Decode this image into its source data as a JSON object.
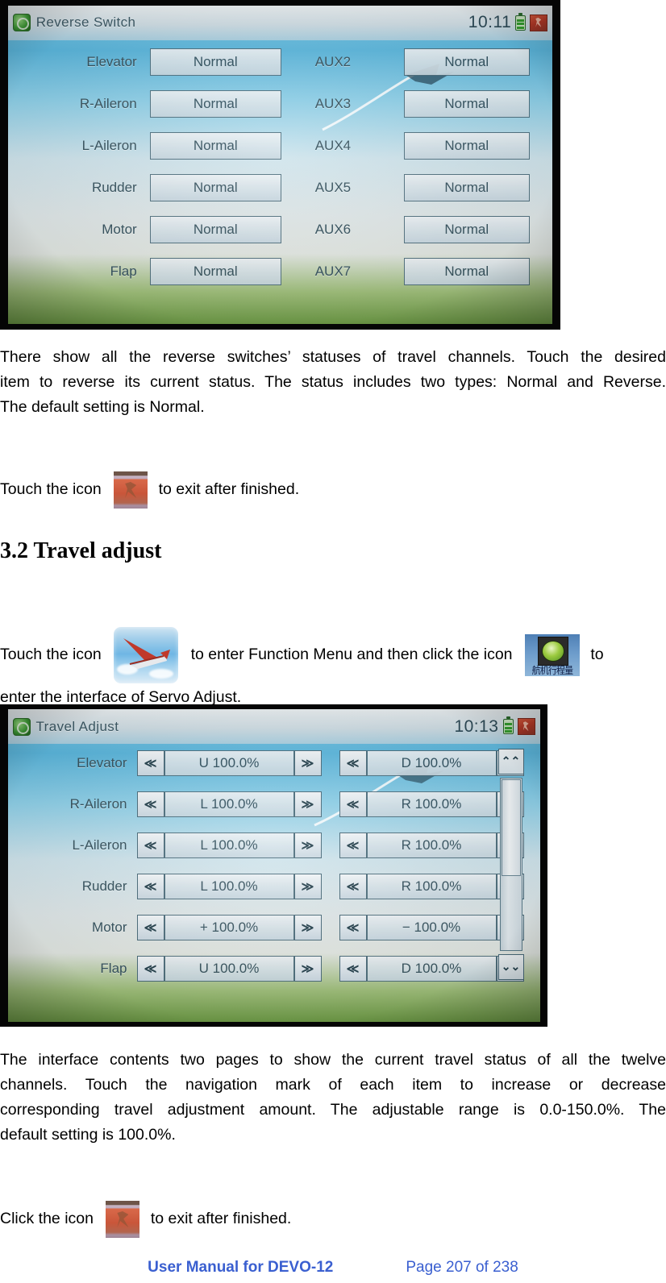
{
  "document": {
    "footer": {
      "manual": "User Manual for DEVO-12",
      "page": "Page 207 of 238"
    }
  },
  "screenshot_reverse_switch": {
    "statusbar": {
      "app_icon": "green-circle-icon",
      "title": "Reverse Switch",
      "time": "10:11",
      "battery_icon": "battery-icon",
      "exit_icon": "exit-icon"
    },
    "rows": [
      {
        "left_label": "Elevator",
        "left_value": "Normal",
        "right_label": "AUX2",
        "right_value": "Normal"
      },
      {
        "left_label": "R-Aileron",
        "left_value": "Normal",
        "right_label": "AUX3",
        "right_value": "Normal"
      },
      {
        "left_label": "L-Aileron",
        "left_value": "Normal",
        "right_label": "AUX4",
        "right_value": "Normal"
      },
      {
        "left_label": "Rudder",
        "left_value": "Normal",
        "right_label": "AUX5",
        "right_value": "Normal"
      },
      {
        "left_label": "Motor",
        "left_value": "Normal",
        "right_label": "AUX6",
        "right_value": "Normal"
      },
      {
        "left_label": "Flap",
        "left_value": "Normal",
        "right_label": "AUX7",
        "right_value": "Normal"
      }
    ]
  },
  "paragraph_1": {
    "line1": "There show all the reverse switches’ statuses of travel channels. Touch the desired",
    "line2": "item to reverse its current status. The status includes two types: Normal and Reverse.",
    "line3": "The default setting is Normal."
  },
  "exit_line_1": {
    "before": "Touch the icon",
    "icon": "exit-icon",
    "after": "to exit after finished."
  },
  "heading": {
    "text": "3.2 Travel adjust"
  },
  "paragraph_2": {
    "before_glider": "Touch the icon",
    "glider_icon": "glider-plane-icon",
    "middle": "to enter Function Menu and then click the icon",
    "travel_icon": "travel-adjust-icon",
    "travel_icon_label": "航机行程量",
    "after": "to",
    "line2": "enter the interface of Servo Adjust."
  },
  "screenshot_travel_adjust": {
    "statusbar": {
      "app_icon": "green-circle-icon",
      "title": "Travel Adjust",
      "time": "10:13",
      "battery_icon": "battery-icon",
      "exit_icon": "exit-icon"
    },
    "left_arrow": "≪",
    "right_arrow": "≫",
    "scroll_up": "⌃⌃",
    "scroll_down": "⌄⌄",
    "rows": [
      {
        "label": "Elevator",
        "value_a": "U 100.0%",
        "value_b": "D 100.0%"
      },
      {
        "label": "R-Aileron",
        "value_a": "L 100.0%",
        "value_b": "R 100.0%"
      },
      {
        "label": "L-Aileron",
        "value_a": "L 100.0%",
        "value_b": "R 100.0%"
      },
      {
        "label": "Rudder",
        "value_a": "L 100.0%",
        "value_b": "R 100.0%"
      },
      {
        "label": "Motor",
        "value_a": "+ 100.0%",
        "value_b": "− 100.0%"
      },
      {
        "label": "Flap",
        "value_a": "U 100.0%",
        "value_b": "D 100.0%"
      }
    ]
  },
  "paragraph_3": {
    "line1": "The interface contents two pages to show the current travel status of all the twelve",
    "line2": "channels. Touch the navigation mark of each item to increase or decrease",
    "line3": "corresponding travel adjustment amount. The adjustable range is 0.0-150.0%. The",
    "line4": "default setting is 100.0%."
  },
  "exit_line_2": {
    "before": "Click the icon",
    "icon": "exit-icon",
    "after": "to exit after finished."
  },
  "colors": {
    "footer_link": "#3a5fd0",
    "screen_sky": "#6fb6e4",
    "battery_green": "#35a02f",
    "exit_red": "#c9563a"
  }
}
